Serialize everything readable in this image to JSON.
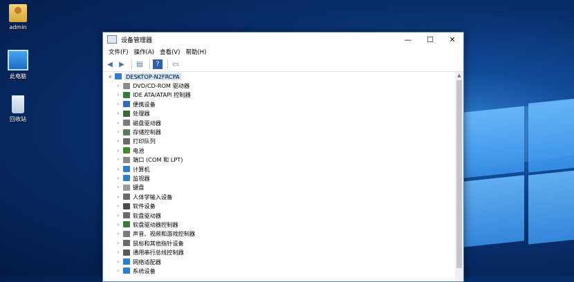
{
  "desktop": {
    "icons": [
      {
        "label": "admin",
        "icon": "user-folder-icon"
      },
      {
        "label": "此电脑",
        "icon": "computer-icon"
      },
      {
        "label": "回收站",
        "icon": "recycle-bin-icon"
      }
    ]
  },
  "window": {
    "title": "设备管理器",
    "controls": {
      "minimize": "—",
      "maximize": "☐",
      "close": "✕"
    },
    "menu": [
      "文件(F)",
      "操作(A)",
      "查看(V)",
      "帮助(H)"
    ],
    "toolbar": [
      "back-icon",
      "forward-icon",
      "properties-icon",
      "help-icon",
      "monitor-icon"
    ],
    "tree": {
      "root": "DESKTOP-N2FRCPA",
      "items": [
        {
          "label": "DVD/CD-ROM 驱动器",
          "icon": "dvd-drive-icon",
          "color": "#8a8a8a"
        },
        {
          "label": "IDE ATA/ATAPI 控制器",
          "icon": "ide-controller-icon",
          "color": "#3a7a3a"
        },
        {
          "label": "便携设备",
          "icon": "portable-device-icon",
          "color": "#2e6db5"
        },
        {
          "label": "处理器",
          "icon": "processor-icon",
          "color": "#3a6a3a"
        },
        {
          "label": "磁盘驱动器",
          "icon": "disk-drive-icon",
          "color": "#7a7a7a"
        },
        {
          "label": "存储控制器",
          "icon": "storage-controller-icon",
          "color": "#5a7a5a"
        },
        {
          "label": "打印队列",
          "icon": "printer-icon",
          "color": "#6a6a6a"
        },
        {
          "label": "电池",
          "icon": "battery-icon",
          "color": "#3e8a2e"
        },
        {
          "label": "端口 (COM 和 LPT)",
          "icon": "port-icon",
          "color": "#8a8a8a"
        },
        {
          "label": "计算机",
          "icon": "computer-icon",
          "color": "#2e7dd0"
        },
        {
          "label": "监视器",
          "icon": "monitor-icon",
          "color": "#2e7dd0"
        },
        {
          "label": "键盘",
          "icon": "keyboard-icon",
          "color": "#9a9a9a"
        },
        {
          "label": "人体学输入设备",
          "icon": "hid-icon",
          "color": "#6a6a6a"
        },
        {
          "label": "软件设备",
          "icon": "software-device-icon",
          "color": "#4a4a4a"
        },
        {
          "label": "软盘驱动器",
          "icon": "floppy-drive-icon",
          "color": "#6a6a6a"
        },
        {
          "label": "软盘驱动器控制器",
          "icon": "floppy-controller-icon",
          "color": "#3a7a3a"
        },
        {
          "label": "声音、视频和游戏控制器",
          "icon": "sound-icon",
          "color": "#7a7a7a"
        },
        {
          "label": "鼠标和其他指针设备",
          "icon": "mouse-icon",
          "color": "#6a6a6a"
        },
        {
          "label": "通用串行总线控制器",
          "icon": "usb-icon",
          "color": "#5a5a5a"
        },
        {
          "label": "网络适配器",
          "icon": "network-adapter-icon",
          "color": "#2e7dd0"
        },
        {
          "label": "系统设备",
          "icon": "system-device-icon",
          "color": "#2e7dd0"
        }
      ]
    }
  }
}
